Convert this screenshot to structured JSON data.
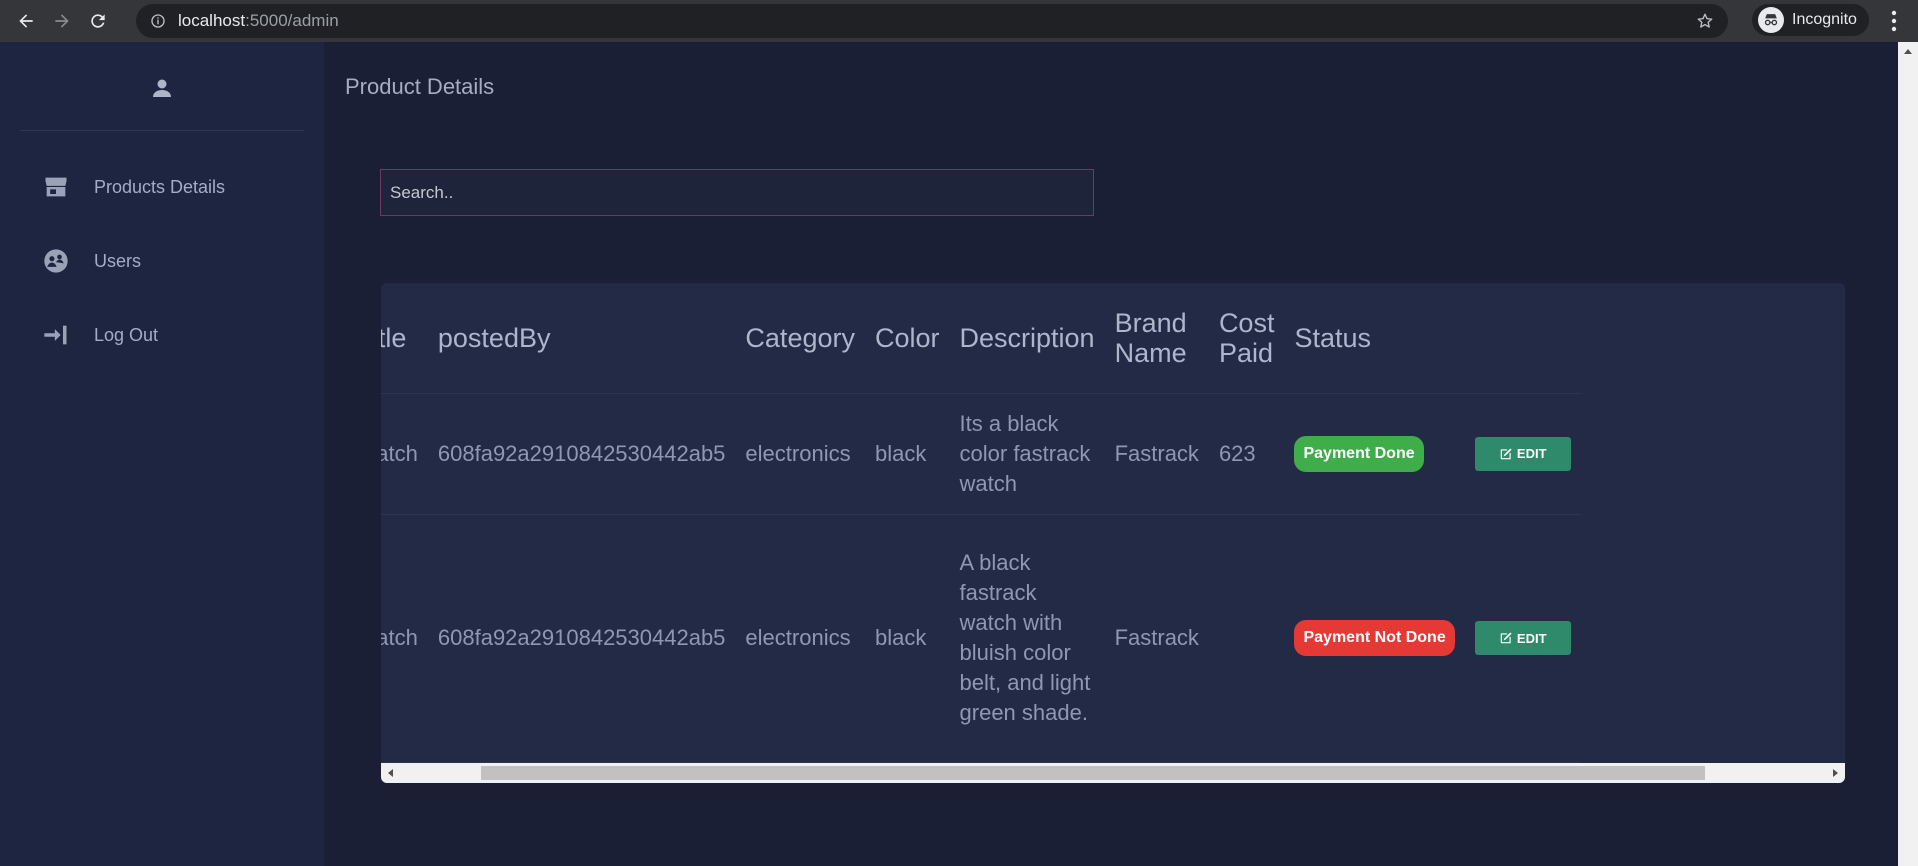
{
  "browser": {
    "url_host": "localhost",
    "url_path": ":5000/admin",
    "profile_label": "Incognito"
  },
  "sidebar": {
    "items": [
      {
        "label": "Products Details",
        "icon": "store-icon"
      },
      {
        "label": "Users",
        "icon": "users-icon"
      },
      {
        "label": "Log Out",
        "icon": "logout-icon"
      }
    ]
  },
  "main": {
    "title": "Product Details",
    "search_placeholder": "Search..",
    "columns": [
      "",
      "Title",
      "postedBy",
      "Category",
      "Color",
      "Description",
      "Brand Name",
      "Cost Paid",
      "Status",
      ""
    ],
    "rows": [
      {
        "id": "0ff15be0a317ca20690",
        "title": "Watch",
        "posted_by": "608fa92a2910842530442ab5",
        "category": "electronics",
        "color": "black",
        "description": "Its a black color fastrack watch",
        "brand": "Fastrack",
        "cost_paid": "623",
        "status": "Payment Done",
        "status_color": "#3fae4a",
        "edit_label": "EDIT"
      },
      {
        "id": "77f0585214988822a22",
        "title": "Watch",
        "posted_by": "608fa92a2910842530442ab5",
        "category": "electronics",
        "color": "black",
        "description": "A black fastrack watch with bluish color belt, and light green shade.",
        "brand": "Fastrack",
        "cost_paid": "",
        "status": "Payment Not Done",
        "status_color": "#e53935",
        "edit_label": "EDIT"
      }
    ]
  }
}
